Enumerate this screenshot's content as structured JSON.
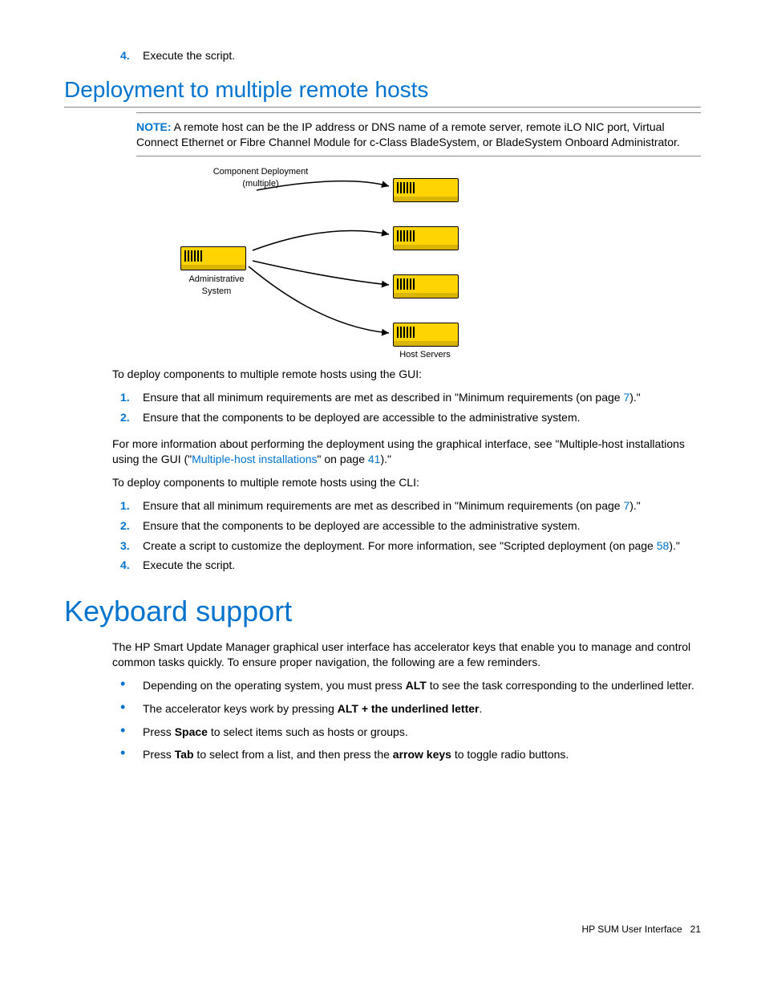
{
  "topStep": {
    "num": "4.",
    "text": "Execute the script."
  },
  "section1": {
    "title": "Deployment to multiple remote hosts",
    "note": {
      "label": "NOTE:",
      "text": " A remote host can be the IP address or DNS name of a remote server, remote iLO NIC port, Virtual Connect Ethernet or Fibre Channel Module for c-Class BladeSystem, or BladeSystem Onboard Administrator."
    },
    "diagram": {
      "compDeploy1": "Component Deployment",
      "compDeploy2": "(multiple)",
      "admin1": "Administrative",
      "admin2": "System",
      "hostServers": "Host Servers"
    },
    "introGUI": "To deploy components to multiple remote hosts using the GUI:",
    "guiSteps": [
      {
        "num": "1.",
        "pre": "Ensure that all minimum requirements are met as described in \"Minimum requirements (on page ",
        "link": "7",
        "post": ").\""
      },
      {
        "num": "2.",
        "text": "Ensure that the components to be deployed are accessible to the administrative system."
      }
    ],
    "moreInfo": {
      "pre": "For more information about performing the deployment using the graphical interface, see \"Multiple-host installations using the GUI (\"",
      "link1": "Multiple-host installations",
      "mid": "\" on page ",
      "link2": "41",
      "post": ").\""
    },
    "introCLI": "To deploy components to multiple remote hosts using the CLI:",
    "cliSteps": [
      {
        "num": "1.",
        "pre": "Ensure that all minimum requirements are met as described in \"Minimum requirements (on page ",
        "link": "7",
        "post": ").\""
      },
      {
        "num": "2.",
        "text": "Ensure that the components to be deployed are accessible to the administrative system."
      },
      {
        "num": "3.",
        "pre": "Create a script to customize the deployment. For more information, see \"Scripted deployment (on page ",
        "link": "58",
        "post": ").\""
      },
      {
        "num": "4.",
        "text": "Execute the script."
      }
    ]
  },
  "section2": {
    "title": "Keyboard support",
    "intro": "The HP Smart Update Manager graphical user interface has accelerator keys that enable you to manage and control common tasks quickly. To ensure proper navigation, the following are a few reminders.",
    "bullets": [
      {
        "pre": "Depending on the operating system, you must press ",
        "b1": "ALT",
        "post": " to see the task corresponding to the underlined letter."
      },
      {
        "pre": "The accelerator keys work by pressing ",
        "b1": "ALT + the underlined letter",
        "post": "."
      },
      {
        "pre": "Press ",
        "b1": "Space",
        "post": " to select items such as hosts or groups."
      },
      {
        "pre": "Press ",
        "b1": "Tab",
        "mid": " to select from a list, and then press the ",
        "b2": "arrow keys",
        "post": " to toggle radio buttons."
      }
    ]
  },
  "footer": {
    "label": "HP SUM User Interface",
    "page": "21"
  }
}
